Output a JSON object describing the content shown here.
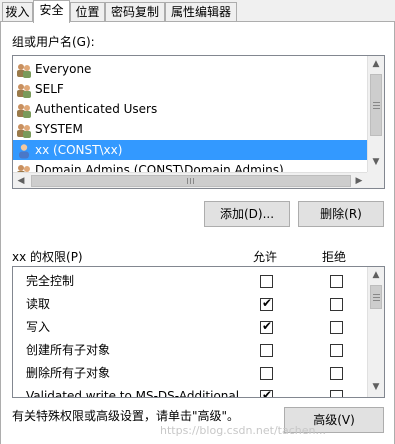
{
  "tabs": [
    {
      "label": "拨入"
    },
    {
      "label": "安全"
    },
    {
      "label": "位置"
    },
    {
      "label": "密码复制"
    },
    {
      "label": "属性编辑器"
    }
  ],
  "groups_label": "组或用户名(G):",
  "users": [
    {
      "name": "Everyone"
    },
    {
      "name": "SELF"
    },
    {
      "name": "Authenticated Users"
    },
    {
      "name": "SYSTEM"
    },
    {
      "name": "xx (CONST\\xx)"
    },
    {
      "name": "Domain Admins (CONST\\Domain Admins)"
    }
  ],
  "buttons": {
    "add": "添加(D)...",
    "remove": "删除(R)",
    "advanced": "高级(V)"
  },
  "permissions_header": {
    "title": "xx 的权限(P)",
    "allow": "允许",
    "deny": "拒绝"
  },
  "permissions": [
    {
      "name": "完全控制",
      "allow": false,
      "deny": false
    },
    {
      "name": "读取",
      "allow": true,
      "deny": false
    },
    {
      "name": "写入",
      "allow": true,
      "deny": false
    },
    {
      "name": "创建所有子对象",
      "allow": false,
      "deny": false
    },
    {
      "name": "删除所有子对象",
      "allow": false,
      "deny": false
    },
    {
      "name": "Validated write to MS-DS-Additional...",
      "allow": true,
      "deny": false
    }
  ],
  "advanced_hint": "有关特殊权限或高级设置，请单击\"高级\"。",
  "watermark": "https://blog.csdn.net/tachen..."
}
